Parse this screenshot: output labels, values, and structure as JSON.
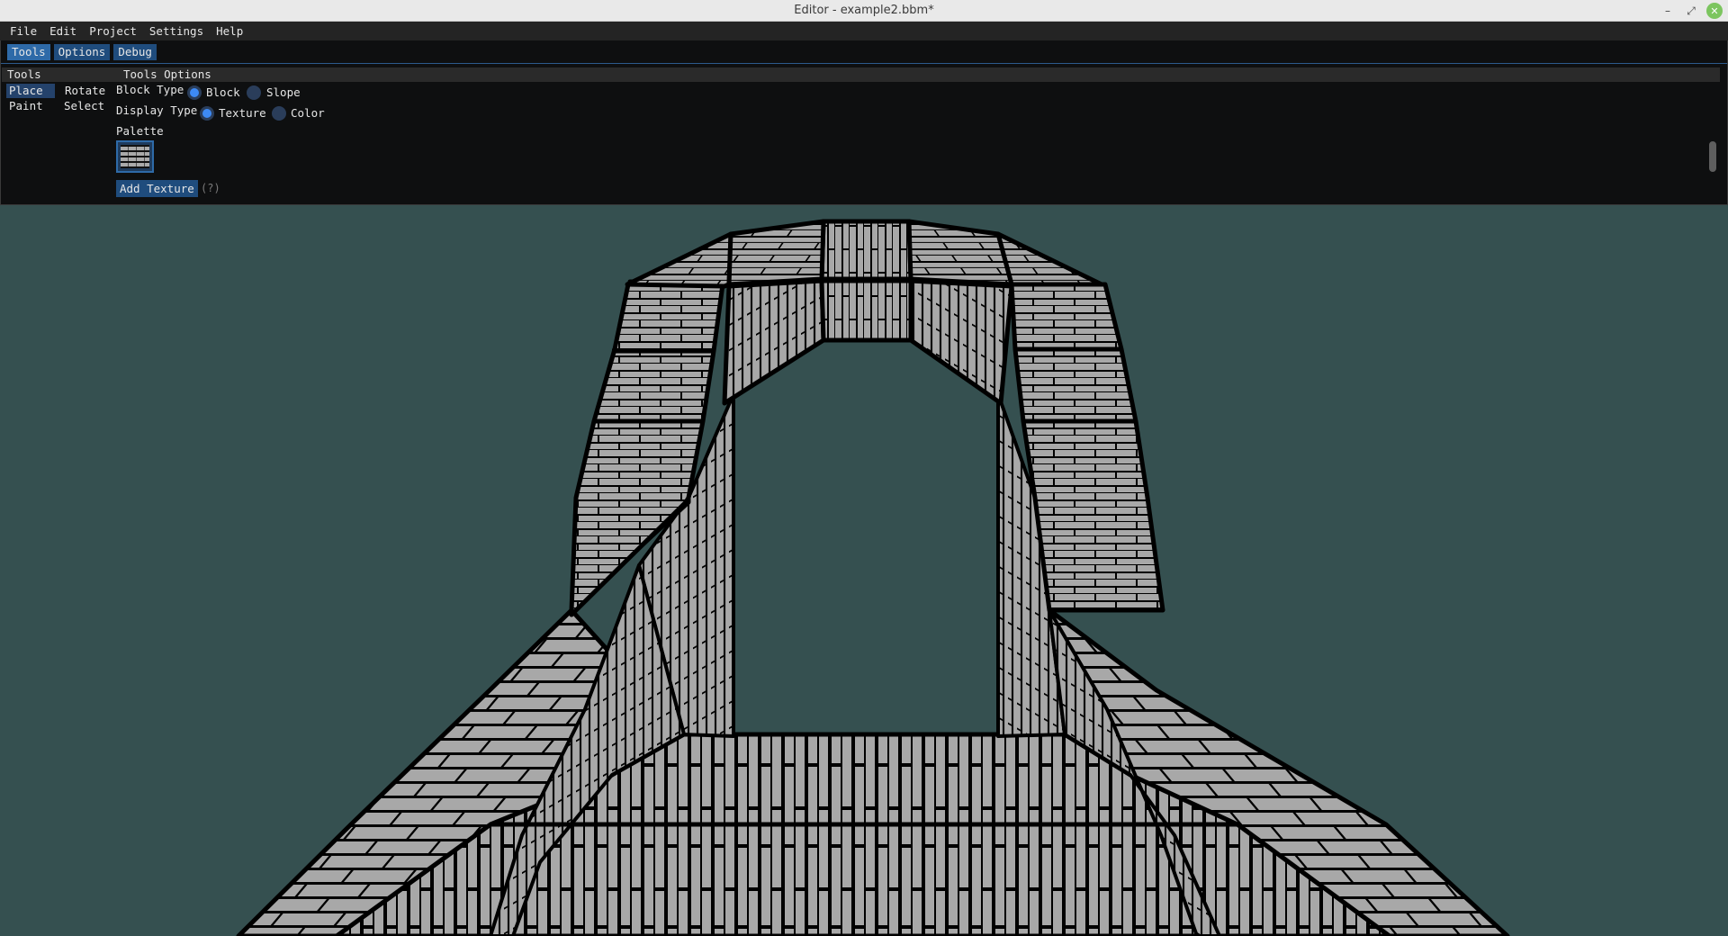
{
  "window": {
    "title": "Editor - example2.bbm*",
    "minimize_glyph": "–",
    "restore_glyph": "⤢",
    "close_glyph": "✕"
  },
  "menu": [
    "File",
    "Edit",
    "Project",
    "Settings",
    "Help"
  ],
  "tabs": [
    "Tools",
    "Options",
    "Debug"
  ],
  "tools_panel": {
    "header": "Tools",
    "items": [
      "Place",
      "Rotate",
      "Paint",
      "Select"
    ],
    "selected": "Place"
  },
  "tools_options": {
    "header": "Tools Options",
    "block_type": {
      "label": "Block Type",
      "options": [
        "Block",
        "Slope"
      ],
      "selected": "Block"
    },
    "display_type": {
      "label": "Display Type",
      "options": [
        "Texture",
        "Color"
      ],
      "selected": "Texture"
    },
    "palette_label": "Palette",
    "add_texture_label": "Add Texture",
    "help_hint": "(?)"
  },
  "colors": {
    "accent": "#2e6aa8",
    "radio_on": "#3d8af5",
    "viewport_bg": "#355050",
    "brick_fill": "#a8a8a8",
    "mortar": "#000000"
  }
}
